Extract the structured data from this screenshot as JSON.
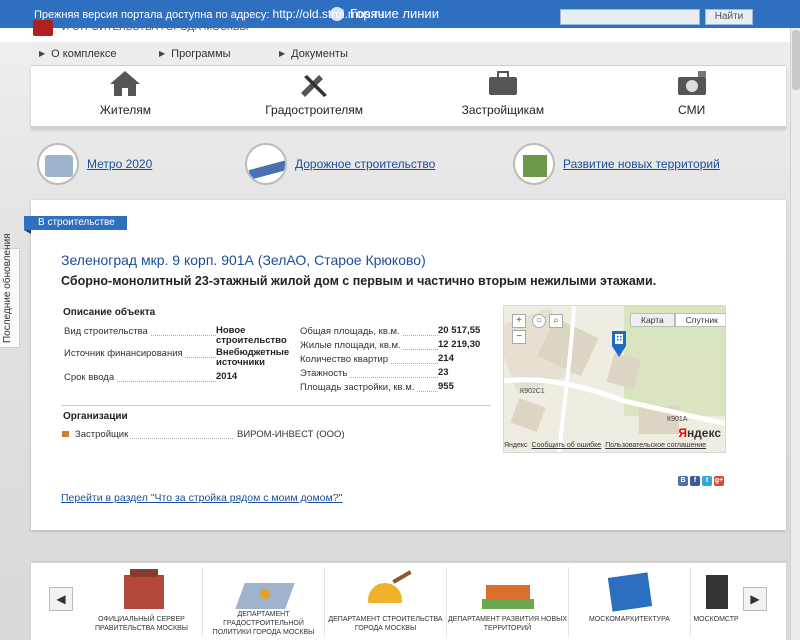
{
  "notice": {
    "prefix": "Прежняя версия портала доступна по адресу:",
    "url": "http://old.stroi.mos.ru"
  },
  "header": {
    "site_name": "И СТРОИТЕЛЬСТВА ГОРОДА МОСКВЫ",
    "hotline": "Горячие линии",
    "search_button": "Найти"
  },
  "menu": [
    "О комплексе",
    "Программы",
    "Документы"
  ],
  "categories": [
    {
      "label": "Жителям",
      "icon": "house-icon"
    },
    {
      "label": "Градостроителям",
      "icon": "tools-icon"
    },
    {
      "label": "Застройщикам",
      "icon": "briefcase-icon"
    },
    {
      "label": "СМИ",
      "icon": "camera-icon"
    }
  ],
  "projects": [
    "Метро 2020",
    "Дорожное строительство",
    "Развитие новых территорий"
  ],
  "sidebar_tab": "Последние обновления",
  "object": {
    "tag": "В строительстве",
    "title": "Зеленоград мкр. 9 корп. 901А (ЗелАО, Старое Крюково)",
    "subtitle": "Сборно-монолитный 23-этажный жилой дом с первым и частично вторым нежилыми этажами.",
    "desc_heading": "Описание объекта",
    "left_props": [
      {
        "label": "Вид строительства",
        "value": "Новое строительство"
      },
      {
        "label": "Источник финансирования",
        "value": "Внебюджетные источники"
      },
      {
        "label": "Срок ввода",
        "value": "2014"
      }
    ],
    "right_props": [
      {
        "label": "Общая площадь, кв.м.",
        "value": "20 517,55"
      },
      {
        "label": "Жилые площади, кв.м.",
        "value": "12 219,30"
      },
      {
        "label": "Количество квартир",
        "value": "214"
      },
      {
        "label": "Этажность",
        "value": "23"
      },
      {
        "label": "Площадь застройки, кв.м.",
        "value": "955"
      }
    ],
    "org_heading": "Организации",
    "org": {
      "label": "Застройщик",
      "value": "ВИРОМ-ИНВЕСТ (ООО)"
    },
    "link": "Перейти в раздел \"Что за стройка рядом с моим домом?\""
  },
  "map": {
    "toggle": [
      "Карта",
      "Спутник"
    ],
    "labels": [
      "К902С1",
      "К901А"
    ],
    "footer_brand": "Яндекс",
    "footer_links": [
      "Сообщить об ошибке",
      "Пользовательское соглашение"
    ],
    "logo_y": "Я",
    "logo_rest": "ндекс"
  },
  "share_icons": [
    "В",
    "f",
    "t",
    "g+"
  ],
  "partners": [
    {
      "name": "Официальный сервер Правительства Москвы"
    },
    {
      "name": "Департамент градостроительной политики города Москвы"
    },
    {
      "name": "Департамент строительства города Москвы"
    },
    {
      "name": "Департамент развития новых территорий"
    },
    {
      "name": "Москомархитектура"
    },
    {
      "name": "Москомстр"
    }
  ]
}
